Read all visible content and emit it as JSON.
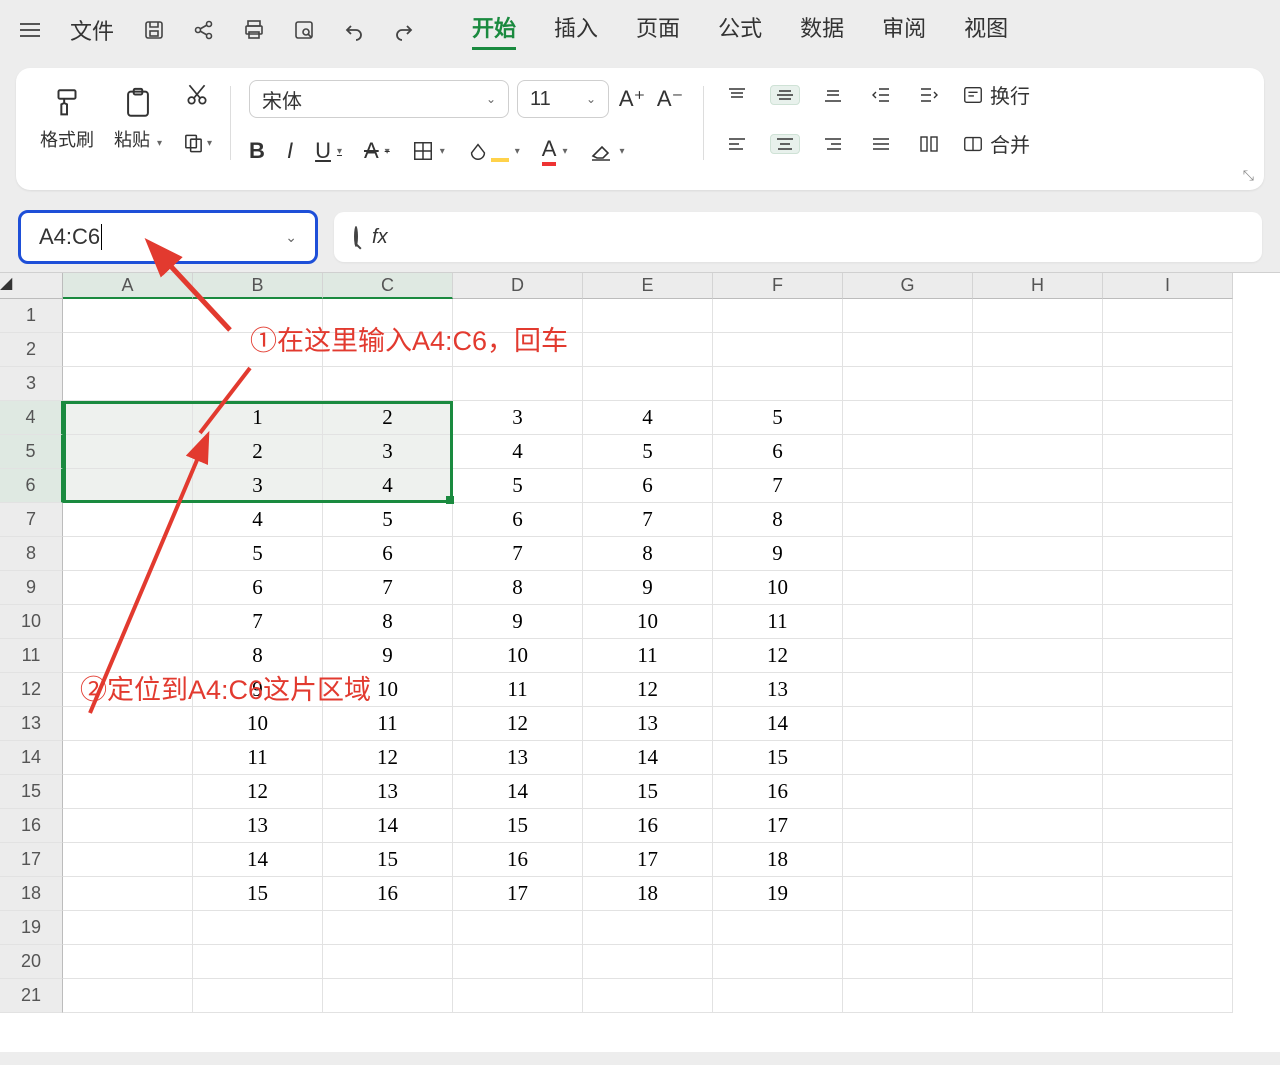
{
  "menubar": {
    "file": "文件",
    "tabs": [
      "开始",
      "插入",
      "页面",
      "公式",
      "数据",
      "审阅",
      "视图"
    ],
    "active_index": 0
  },
  "ribbon": {
    "format_painter": "格式刷",
    "paste": "粘贴",
    "font_name": "宋体",
    "font_size": "11",
    "wrap_text": "换行",
    "merge": "合并"
  },
  "namebox": {
    "value": "A4:C6"
  },
  "grid": {
    "columns": [
      "A",
      "B",
      "C",
      "D",
      "E",
      "F",
      "G",
      "H",
      "I"
    ],
    "row_count": 21,
    "selected_cols": [
      0,
      1,
      2
    ],
    "selected_rows": [
      4,
      5,
      6
    ],
    "data": {
      "4": {
        "B": "1",
        "C": "2",
        "D": "3",
        "E": "4",
        "F": "5"
      },
      "5": {
        "B": "2",
        "C": "3",
        "D": "4",
        "E": "5",
        "F": "6"
      },
      "6": {
        "B": "3",
        "C": "4",
        "D": "5",
        "E": "6",
        "F": "7"
      },
      "7": {
        "B": "4",
        "C": "5",
        "D": "6",
        "E": "7",
        "F": "8"
      },
      "8": {
        "B": "5",
        "C": "6",
        "D": "7",
        "E": "8",
        "F": "9"
      },
      "9": {
        "B": "6",
        "C": "7",
        "D": "8",
        "E": "9",
        "F": "10"
      },
      "10": {
        "B": "7",
        "C": "8",
        "D": "9",
        "E": "10",
        "F": "11"
      },
      "11": {
        "B": "8",
        "C": "9",
        "D": "10",
        "E": "11",
        "F": "12"
      },
      "12": {
        "B": "9",
        "C": "10",
        "D": "11",
        "E": "12",
        "F": "13"
      },
      "13": {
        "B": "10",
        "C": "11",
        "D": "12",
        "E": "13",
        "F": "14"
      },
      "14": {
        "B": "11",
        "C": "12",
        "D": "13",
        "E": "14",
        "F": "15"
      },
      "15": {
        "B": "12",
        "C": "13",
        "D": "14",
        "E": "15",
        "F": "16"
      },
      "16": {
        "B": "13",
        "C": "14",
        "D": "15",
        "E": "16",
        "F": "17"
      },
      "17": {
        "B": "14",
        "C": "15",
        "D": "16",
        "E": "17",
        "F": "18"
      },
      "18": {
        "B": "15",
        "C": "16",
        "D": "17",
        "E": "18",
        "F": "19"
      }
    }
  },
  "annotations": {
    "one": "①在这里输入A4:C6，回车",
    "two": "②定位到A4:C6这片区域"
  }
}
